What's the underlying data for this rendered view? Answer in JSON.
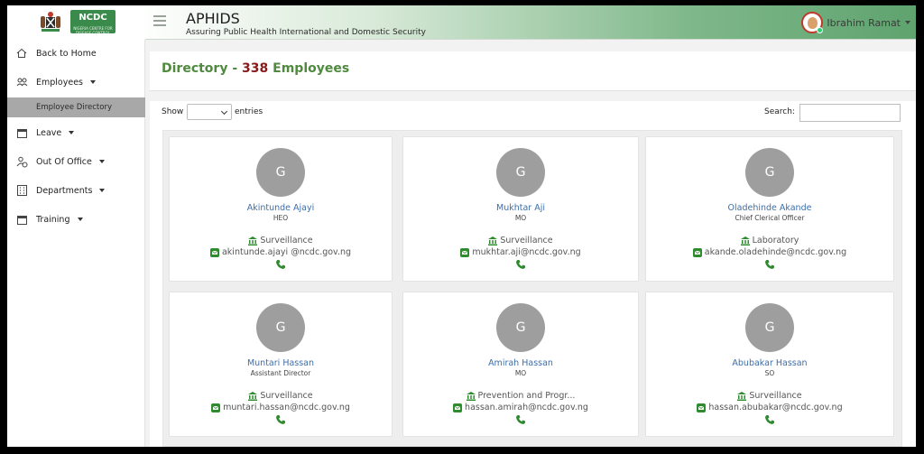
{
  "header": {
    "logo_text": "NCDC",
    "logo_subtext": "NIGERIA CENTRE FOR DISEASE CONTROL",
    "app_title": "APHIDS",
    "app_subtitle": "Assuring Public Health International and Domestic Security",
    "user_name": "Ibrahim Ramat"
  },
  "sidebar": {
    "items": [
      {
        "label": "Back to Home",
        "icon": "home-icon"
      },
      {
        "label": "Employees",
        "icon": "users-icon"
      },
      {
        "label": "Employee Directory"
      },
      {
        "label": "Leave",
        "icon": "calendar-icon"
      },
      {
        "label": "Out Of Office",
        "icon": "person-clock-icon"
      },
      {
        "label": "Departments",
        "icon": "building-icon"
      },
      {
        "label": "Training",
        "icon": "calendar-icon"
      }
    ]
  },
  "page": {
    "title_prefix": "Directory - ",
    "count": "338",
    "title_suffix": " Employees"
  },
  "controls": {
    "show_label": "Show",
    "entries_label": "entries",
    "search_label": "Search:"
  },
  "employees": [
    {
      "initial": "G",
      "name": "Akintunde Ajayi",
      "role": "HEO",
      "dept": "Surveillance",
      "email": "akintunde.ajayi @ncdc.gov.ng"
    },
    {
      "initial": "G",
      "name": "Mukhtar Aji",
      "role": "MO",
      "dept": "Surveillance",
      "email": "mukhtar.aji@ncdc.gov.ng"
    },
    {
      "initial": "G",
      "name": "Oladehinde Akande",
      "role": "Chief Clerical Officer",
      "dept": "Laboratory",
      "email": "akande.oladehinde@ncdc.gov.ng"
    },
    {
      "initial": "G",
      "name": "Muntari Hassan",
      "role": "Assistant Director",
      "dept": "Surveillance",
      "email": "muntari.hassan@ncdc.gov.ng"
    },
    {
      "initial": "G",
      "name": "Amirah Hassan",
      "role": "MO",
      "dept": "Prevention and Progr...",
      "email": "hassan.amirah@ncdc.gov.ng"
    },
    {
      "initial": "G",
      "name": "Abubakar Hassan",
      "role": "SO",
      "dept": "Surveillance",
      "email": "hassan.abubakar@ncdc.gov.ng"
    }
  ],
  "colors": {
    "title_green": "#4f8a3f",
    "count_red": "#8a1a1a",
    "name_blue": "#3c6ea8",
    "icon_green": "#2e8b2e"
  }
}
